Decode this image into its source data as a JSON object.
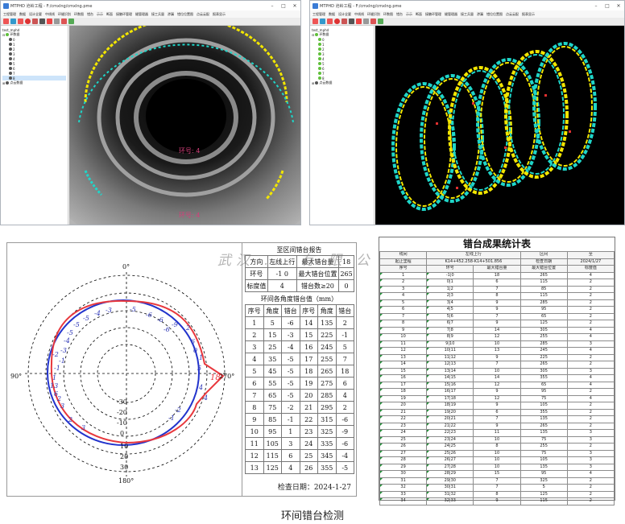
{
  "left_window": {
    "title": "MTPHD  沧岭工程 - F:/cmxlng/cmxlng.pme",
    "menu": [
      "工程管理",
      "数据",
      "设计全要",
      "中线线",
      "环缝识别",
      "环数图",
      "错台",
      "示示",
      "断面",
      "接触环管理",
      "缝管理器",
      "接工兵量",
      "渗漏",
      "错位位置图",
      "点云云配",
      "报表显示"
    ],
    "tree_root": "test_mphd",
    "tree_node": "环数据",
    "tree_items": [
      "0",
      "1",
      "2",
      "3",
      "4",
      "5",
      "6",
      "7",
      "8"
    ],
    "tree_footer": "点云数据",
    "ring_label_1": "环号: 4",
    "ring_label_2": "环号: 4"
  },
  "right_window": {
    "title": "MTPHD  沧岭工程 - F:/cmxlng/cmxlng.pme",
    "menu": [
      "工程管理",
      "数据",
      "设计全要",
      "中线线",
      "环缝识别",
      "环数图",
      "错台",
      "示示",
      "断面",
      "接触环管理",
      "缝管理器",
      "接工兵量",
      "渗漏",
      "错位位置图",
      "点云云配",
      "报表显示"
    ],
    "tree_root": "test_mphd",
    "tree_node": "环数据",
    "tree_items": [
      "0",
      "1",
      "2",
      "3",
      "4",
      "5",
      "6",
      "7",
      "8"
    ],
    "tree_footer": "点云数据"
  },
  "polar": {
    "angle_labels": {
      "top": "0°",
      "right": "270°",
      "bottom": "180°",
      "left": "90°"
    },
    "ring_labels_up": [
      "-30",
      "-20",
      "-10",
      "0"
    ],
    "ring_labels_down": [
      "10",
      "20",
      "30"
    ],
    "numbers": [
      "-5",
      "-3",
      "-4",
      "-5",
      "-6",
      "-6",
      "-5",
      "-5",
      "-4",
      "-3",
      "-1",
      "-2",
      "-1",
      "1",
      "2",
      "3",
      "2",
      "3",
      "2",
      "-2",
      "-1",
      "0",
      "13",
      "6",
      "6",
      "1",
      "5",
      "4",
      "-9",
      "-6",
      "18",
      "4"
    ]
  },
  "report": {
    "title": "至区间错台报告",
    "r1": [
      "方向",
      "左线上行",
      "最大错台量",
      "18"
    ],
    "r2": [
      "环号",
      "-1",
      "0",
      "最大错台位置",
      "265"
    ],
    "r3": [
      "标度值",
      "4",
      "错台数≥20",
      "0"
    ],
    "section": "环间各角度错台值（mm）",
    "headers": [
      "序号",
      "角度",
      "错台",
      "序号",
      "角度",
      "错台"
    ],
    "rows": [
      [
        "1",
        "5",
        "-6",
        "14",
        "135",
        "2"
      ],
      [
        "2",
        "15",
        "-3",
        "15",
        "225",
        "-1"
      ],
      [
        "3",
        "25",
        "-4",
        "16",
        "245",
        "5"
      ],
      [
        "4",
        "35",
        "-5",
        "17",
        "255",
        "7"
      ],
      [
        "5",
        "45",
        "-5",
        "18",
        "265",
        "18"
      ],
      [
        "6",
        "55",
        "-5",
        "19",
        "275",
        "6"
      ],
      [
        "7",
        "65",
        "-5",
        "20",
        "285",
        "4"
      ],
      [
        "8",
        "75",
        "-2",
        "21",
        "295",
        "2"
      ],
      [
        "9",
        "85",
        "-1",
        "22",
        "315",
        "-6"
      ],
      [
        "10",
        "95",
        "1",
        "23",
        "325",
        "-9"
      ],
      [
        "11",
        "105",
        "3",
        "24",
        "335",
        "-6"
      ],
      [
        "12",
        "115",
        "6",
        "25",
        "345",
        "-4"
      ],
      [
        "13",
        "125",
        "4",
        "26",
        "355",
        "-5"
      ]
    ],
    "date": "检查日期：2024-1-27"
  },
  "watermark": "武汉 ... 有 限 公 司",
  "stats": {
    "title": "错台成果统计表",
    "meta1": [
      "线间",
      "左线上行",
      "区间",
      "至"
    ],
    "meta2": [
      "起止里程",
      "K14+452.258-K14+501.856",
      "检查日期",
      "2024/1/27"
    ],
    "headers": [
      "序号",
      "环号",
      "最大错台量",
      "最大错台位置",
      "标度值"
    ],
    "rows": [
      [
        "1",
        "-1|0",
        "18",
        "265",
        "4"
      ],
      [
        "2",
        "0|1",
        "6",
        "115",
        "2"
      ],
      [
        "3",
        "1|2",
        "7",
        "85",
        "2"
      ],
      [
        "4",
        "2|3",
        "8",
        "115",
        "2"
      ],
      [
        "5",
        "3|4",
        "9",
        "285",
        "2"
      ],
      [
        "6",
        "4|5",
        "9",
        "95",
        "2"
      ],
      [
        "7",
        "5|6",
        "7",
        "65",
        "2"
      ],
      [
        "8",
        "6|7",
        "9",
        "125",
        "2"
      ],
      [
        "9",
        "7|8",
        "14",
        "305",
        "4"
      ],
      [
        "10",
        "8|9",
        "12",
        "255",
        "4"
      ],
      [
        "11",
        "9|10",
        "10",
        "285",
        "3"
      ],
      [
        "12",
        "10|11",
        "13",
        "245",
        "4"
      ],
      [
        "13",
        "11|12",
        "9",
        "225",
        "2"
      ],
      [
        "14",
        "12|13",
        "7",
        "265",
        "2"
      ],
      [
        "15",
        "13|14",
        "10",
        "305",
        "3"
      ],
      [
        "16",
        "14|15",
        "14",
        "355",
        "4"
      ],
      [
        "17",
        "15|16",
        "12",
        "65",
        "4"
      ],
      [
        "18",
        "16|17",
        "9",
        "95",
        "2"
      ],
      [
        "19",
        "17|18",
        "12",
        "75",
        "4"
      ],
      [
        "20",
        "18|19",
        "9",
        "105",
        "2"
      ],
      [
        "21",
        "19|20",
        "6",
        "355",
        "2"
      ],
      [
        "22",
        "20|21",
        "7",
        "135",
        "2"
      ],
      [
        "23",
        "21|22",
        "9",
        "265",
        "2"
      ],
      [
        "24",
        "22|23",
        "11",
        "135",
        "3"
      ],
      [
        "25",
        "23|24",
        "10",
        "75",
        "3"
      ],
      [
        "26",
        "24|25",
        "8",
        "255",
        "2"
      ],
      [
        "27",
        "25|26",
        "10",
        "75",
        "3"
      ],
      [
        "28",
        "26|27",
        "10",
        "105",
        "3"
      ],
      [
        "29",
        "27|28",
        "10",
        "135",
        "3"
      ],
      [
        "30",
        "28|29",
        "15",
        "95",
        "4"
      ],
      [
        "31",
        "29|30",
        "7",
        "325",
        "2"
      ],
      [
        "32",
        "30|31",
        "7",
        "5",
        "2"
      ],
      [
        "33",
        "31|32",
        "8",
        "125",
        "2"
      ],
      [
        "34",
        "32|33",
        "9",
        "115",
        "2"
      ]
    ]
  },
  "caption": "环间错台检测",
  "colors": {
    "yellow": "#f2e600",
    "cyan": "#1fd6c9",
    "blue_ring": "#2233cc",
    "red_ring": "#e8383d",
    "ring_label": "#d43f7a"
  }
}
